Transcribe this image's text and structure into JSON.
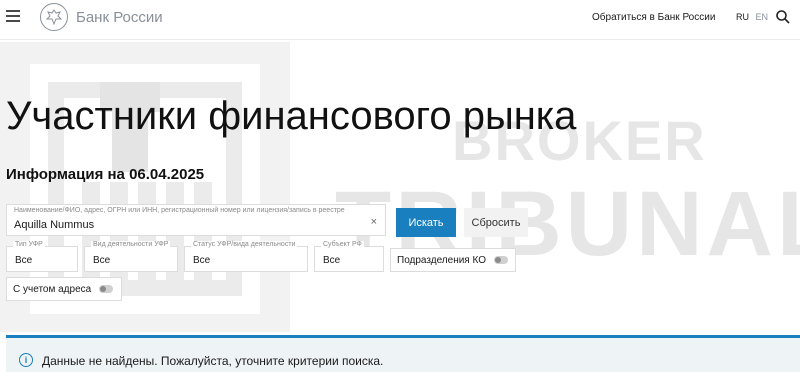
{
  "header": {
    "site_name": "Банк России",
    "contact_link": "Обратиться в Банк России",
    "lang_ru": "RU",
    "lang_en": "EN"
  },
  "watermark": {
    "line1": "BROKER",
    "line2": "TRIBUNAL"
  },
  "page": {
    "title": "Участники финансового рынка",
    "info_date": "Информация на 06.04.2025"
  },
  "search": {
    "label": "Наименование/ФИО, адрес, ОГРН или ИНН, регистрационный номер или лицензия/запись в реестре",
    "value": "Aquilla Nummus",
    "clear": "×",
    "search_button": "Искать",
    "reset_button": "Сбросить"
  },
  "filters": [
    {
      "label": "Тип УФР",
      "value": "Все"
    },
    {
      "label": "Вид деятельности УФР",
      "value": "Все"
    },
    {
      "label": "Статус УФР/вида деятельности",
      "value": "Все"
    },
    {
      "label": "Субъект РФ",
      "value": "Все"
    }
  ],
  "toggles": {
    "branches": "Подразделения КО",
    "with_address": "С учетом адреса"
  },
  "notice": {
    "icon": "i",
    "message": "Данные не найдены. Пожалуйста, уточните критерии поиска."
  },
  "colors": {
    "accent": "#1a7fbf",
    "notice_bg": "#eef3f6",
    "watermark": "#e6e6e6"
  }
}
